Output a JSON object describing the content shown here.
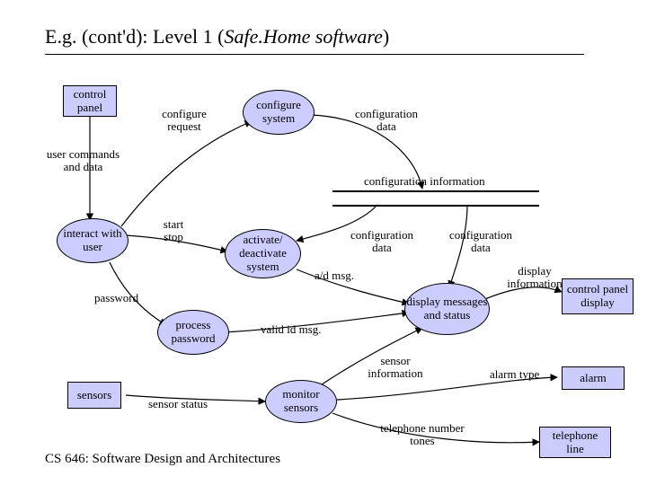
{
  "title_prefix": "E.g. (cont'd): Level 1 (",
  "title_italic": "Safe.Home software",
  "title_suffix": ")",
  "footer": "CS 646: Software Design and Architectures",
  "nodes": {
    "control_panel": "control panel",
    "sensors": "sensors",
    "control_panel_display": "control panel display",
    "alarm": "alarm",
    "telephone_line": "telephone line",
    "interact_with_user": "interact with user",
    "configure_system": "configure system",
    "activate_deactivate_system": "activate/ deactivate system",
    "process_password": "process password",
    "display_messages_and_status": "display messages and status",
    "monitor_sensors": "monitor sensors"
  },
  "store": "configuration information",
  "flows": {
    "user_commands_and_data": "user commands and data",
    "configure_request": "configure request",
    "configuration_data": "configuration data",
    "start_stop": "start stop",
    "password": "password",
    "activate_deactivate": "activate/ deactivate system",
    "ad_msg": "a/d msg.",
    "valid_id_msg": "valid id msg.",
    "sensor_status": "sensor status",
    "sensor_information": "sensor information",
    "alarm_type": "alarm type",
    "telephone_number_tones": "telephone number tones",
    "display_information": "display information"
  }
}
